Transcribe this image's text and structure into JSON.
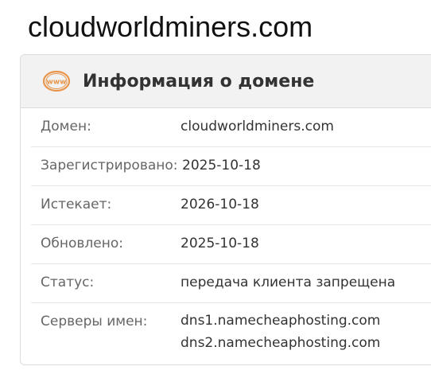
{
  "page": {
    "title": "cloudworldminers.com"
  },
  "card": {
    "title": "Информация о домене",
    "icon": "www-icon",
    "accent_color": "#e8964d"
  },
  "rows": {
    "domain": {
      "label": "Домен:",
      "value": "cloudworldminers.com"
    },
    "registered": {
      "label": "Зарегистрировано:",
      "value": "2025-10-18"
    },
    "expires": {
      "label": "Истекает:",
      "value": "2026-10-18"
    },
    "updated": {
      "label": "Обновлено:",
      "value": "2025-10-18"
    },
    "status": {
      "label": "Статус:",
      "value": "передача клиента запрещена"
    },
    "nameservers": {
      "label": "Серверы имен:",
      "values": [
        "dns1.namecheaphosting.com",
        "dns2.namecheaphosting.com"
      ]
    }
  }
}
